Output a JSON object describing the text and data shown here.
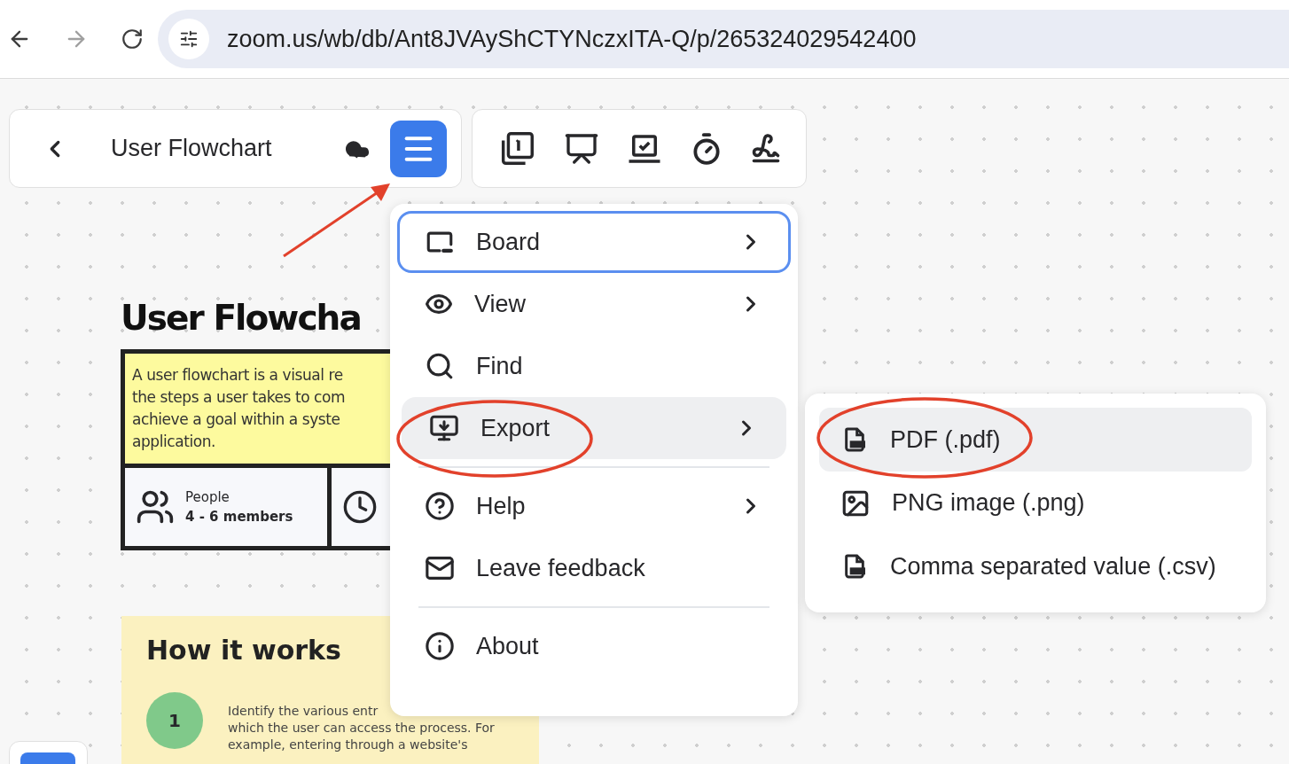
{
  "browser": {
    "url": "zoom.us/wb/db/Ant8JVAyShCTYNczxITA-Q/p/265324029542400"
  },
  "header": {
    "title": "User Flowchart"
  },
  "board": {
    "title": "User Flowcha",
    "description": [
      "A user flowchart is a visual re",
      "the steps a user takes to com",
      "achieve a goal within a syste",
      "application."
    ],
    "info_label": "People",
    "info_value": "4 - 6 members",
    "how_title": "How it works",
    "step_number": "1",
    "step_lines": [
      "Identify the various entr",
      "which the user can access the process. For",
      "example, entering through a website's"
    ]
  },
  "menu": [
    {
      "kind": "item",
      "label": "Board",
      "submenu": true,
      "focused": true,
      "selected": false
    },
    {
      "kind": "item",
      "label": "View",
      "submenu": true,
      "focused": false,
      "selected": false
    },
    {
      "kind": "item",
      "label": "Find",
      "submenu": false,
      "focused": false,
      "selected": false
    },
    {
      "kind": "item",
      "label": "Export",
      "submenu": true,
      "focused": false,
      "selected": true
    },
    {
      "kind": "divider"
    },
    {
      "kind": "item",
      "label": "Help",
      "submenu": true,
      "focused": false,
      "selected": false
    },
    {
      "kind": "item",
      "label": "Leave feedback",
      "submenu": false,
      "focused": false,
      "selected": false
    },
    {
      "kind": "divider"
    },
    {
      "kind": "item",
      "label": "About",
      "submenu": false,
      "focused": false,
      "selected": false
    }
  ],
  "submenu": [
    {
      "label": "PDF (.pdf)",
      "selected": true
    },
    {
      "label": "PNG image (.png)",
      "selected": false
    },
    {
      "label": "Comma separated value (.csv)",
      "selected": false
    }
  ]
}
